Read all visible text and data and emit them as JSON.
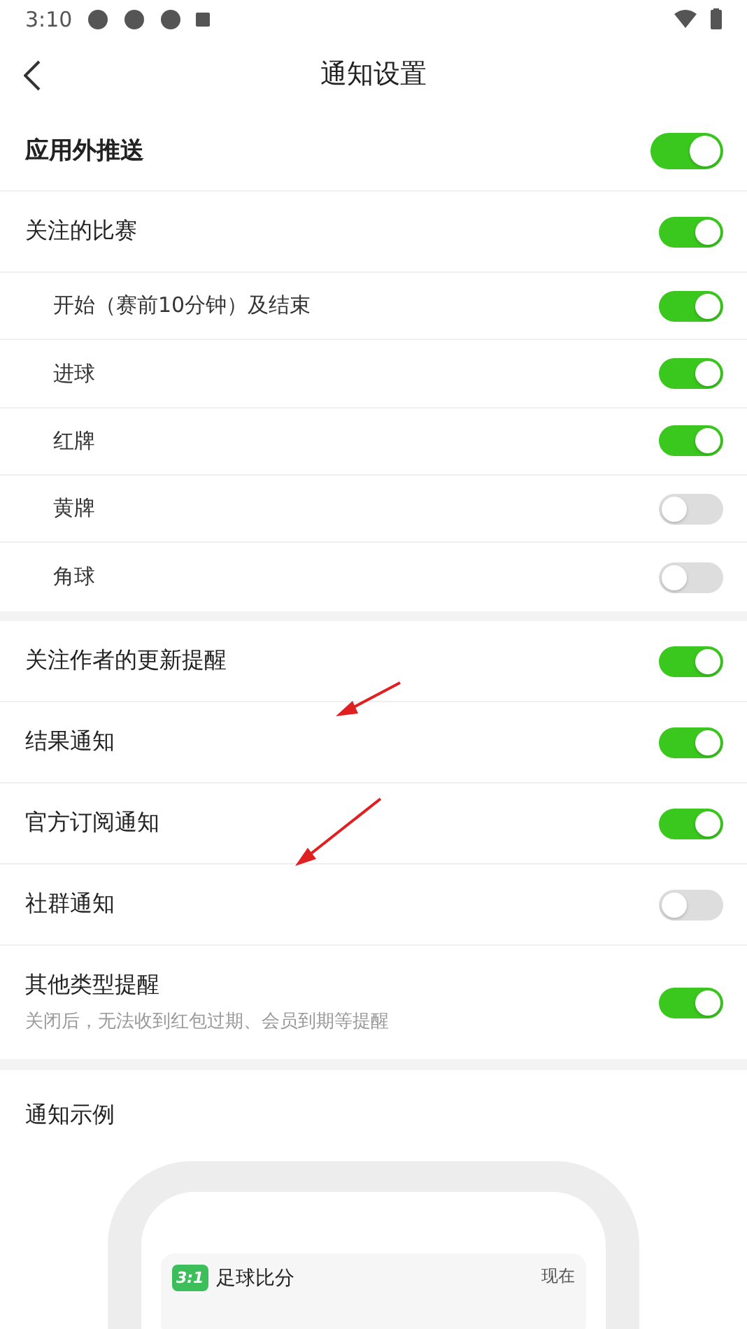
{
  "status_bar": {
    "time": "3:10"
  },
  "header": {
    "title": "通知设置"
  },
  "master": {
    "label": "应用外推送",
    "on": true
  },
  "followed": {
    "label": "关注的比赛",
    "on": true,
    "children": [
      {
        "label": "开始（赛前10分钟）及结束",
        "on": true
      },
      {
        "label": "进球",
        "on": true
      },
      {
        "label": "红牌",
        "on": true
      },
      {
        "label": "黄牌",
        "on": false
      },
      {
        "label": "角球",
        "on": false
      }
    ]
  },
  "others": [
    {
      "label": "关注作者的更新提醒",
      "on": true
    },
    {
      "label": "结果通知",
      "on": true
    },
    {
      "label": "官方订阅通知",
      "on": true
    },
    {
      "label": "社群通知",
      "on": false
    },
    {
      "label": "其他类型提醒",
      "hint": "关闭后，无法收到红包过期、会员到期等提醒",
      "on": true
    }
  ],
  "example": {
    "title": "通知示例",
    "app_badge": "3:1",
    "app_name": "足球比分",
    "time": "现在"
  }
}
